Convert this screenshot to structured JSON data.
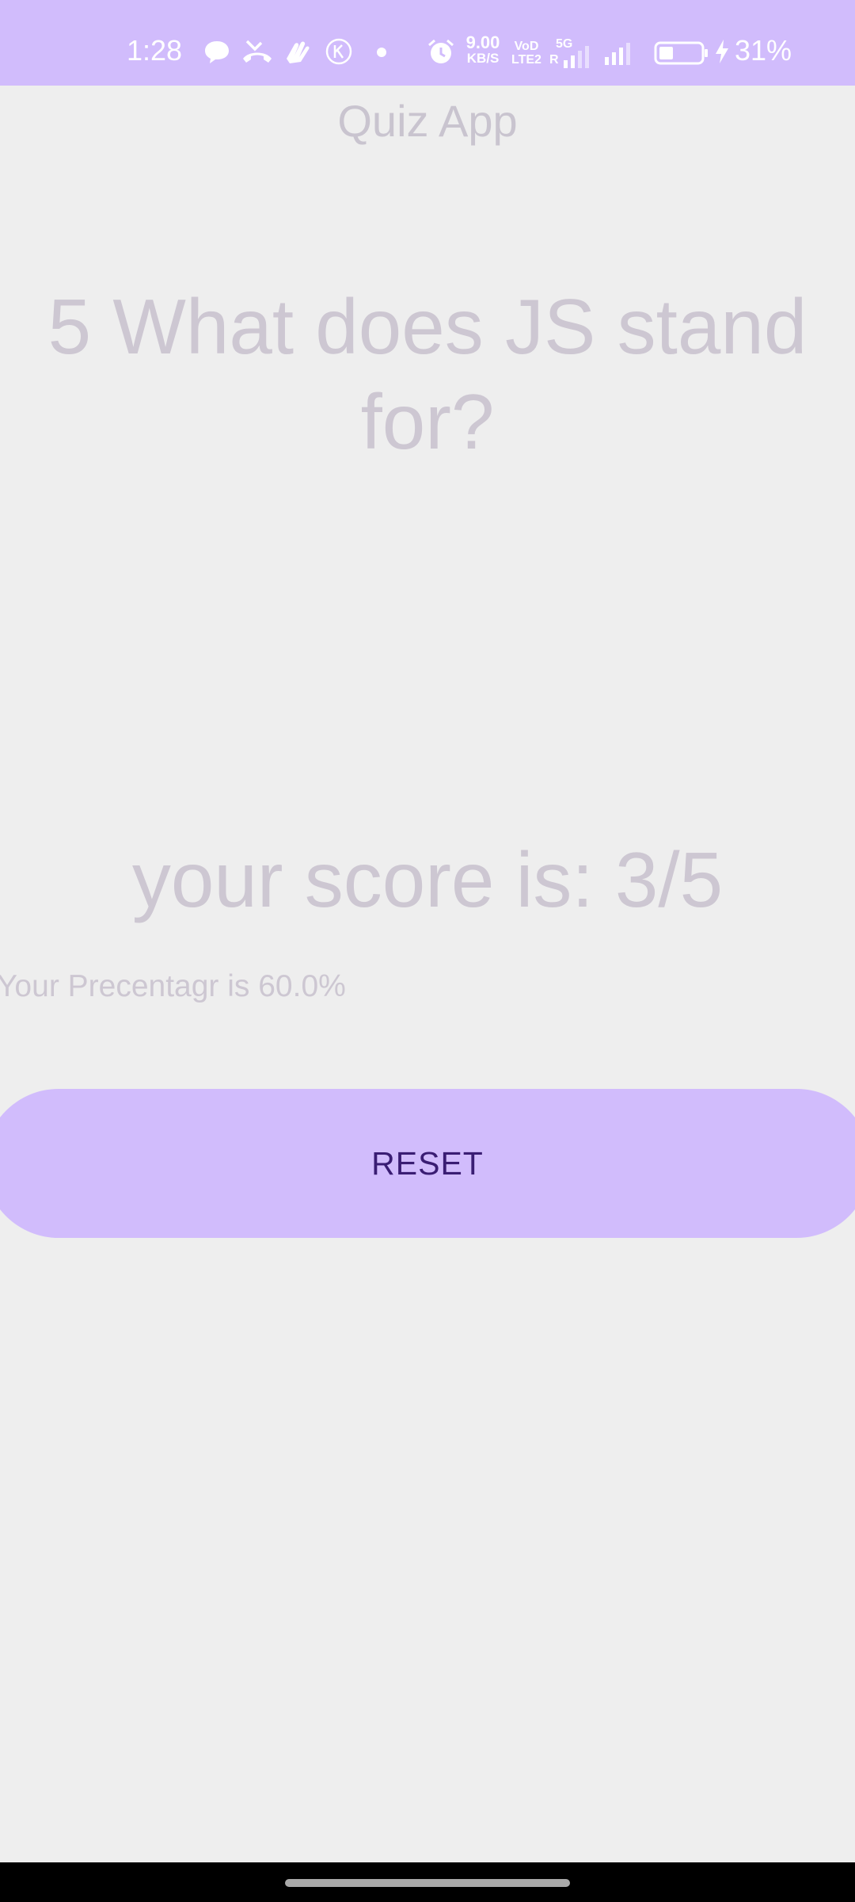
{
  "status_bar": {
    "time": "1:28",
    "net_speed_value": "9.00",
    "net_speed_unit": "KB/S",
    "volte_top": "VoD",
    "volte_bottom": "LTE2",
    "network_5g": "5G",
    "sim_r": "R",
    "battery_percent": "31%",
    "battery_level": 0.31,
    "icons": [
      "chat-bubble-icon",
      "missed-call-icon",
      "hands-icon",
      "k-circle-icon",
      "dot-icon",
      "alarm-icon",
      "signal-icon",
      "signal-icon",
      "battery-icon",
      "charging-bolt-icon"
    ]
  },
  "app": {
    "title": "Quiz App"
  },
  "quiz": {
    "question": "5 What does JS stand for?",
    "score_text": "your score is: 3/5",
    "percentage_text": "Your Precentagr is 60.0%"
  },
  "actions": {
    "reset_label": "RESET"
  },
  "colors": {
    "accent": "#d1bcfc",
    "button_text": "#3a1d73",
    "background": "#eeeeee",
    "faded_text": "#cdc7d2"
  }
}
